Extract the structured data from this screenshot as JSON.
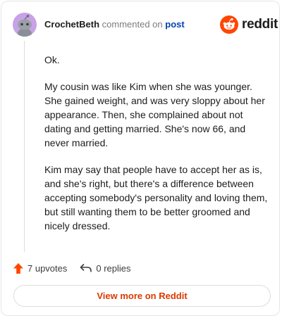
{
  "comment": {
    "username": "CrochetBeth",
    "action_text": "commented on",
    "target_link": "post",
    "paragraphs": [
      "Ok.",
      "My cousin was like Kim when she was younger. She gained weight, and was very sloppy about her appearance. Then, she complained about not dating and getting married. She's now 66, and never married.",
      "Kim may say that people have to accept her as is, and she's right, but there's a difference between accepting somebody's personality and loving them, but still wanting them to be better groomed and nicely dressed."
    ]
  },
  "brand": {
    "logo_text": "reddit",
    "accent": "#ff4500"
  },
  "actions": {
    "upvotes": "7 upvotes",
    "replies": "0 replies",
    "upvote_color": "#ff4500"
  },
  "footer": {
    "view_more_label": "View more on Reddit",
    "view_more_color": "#d93a00"
  },
  "icons": {
    "avatar": "snoo-avatar",
    "logo": "reddit-logo-icon",
    "upvote": "upvote-arrow-icon",
    "reply": "reply-arrow-icon"
  }
}
